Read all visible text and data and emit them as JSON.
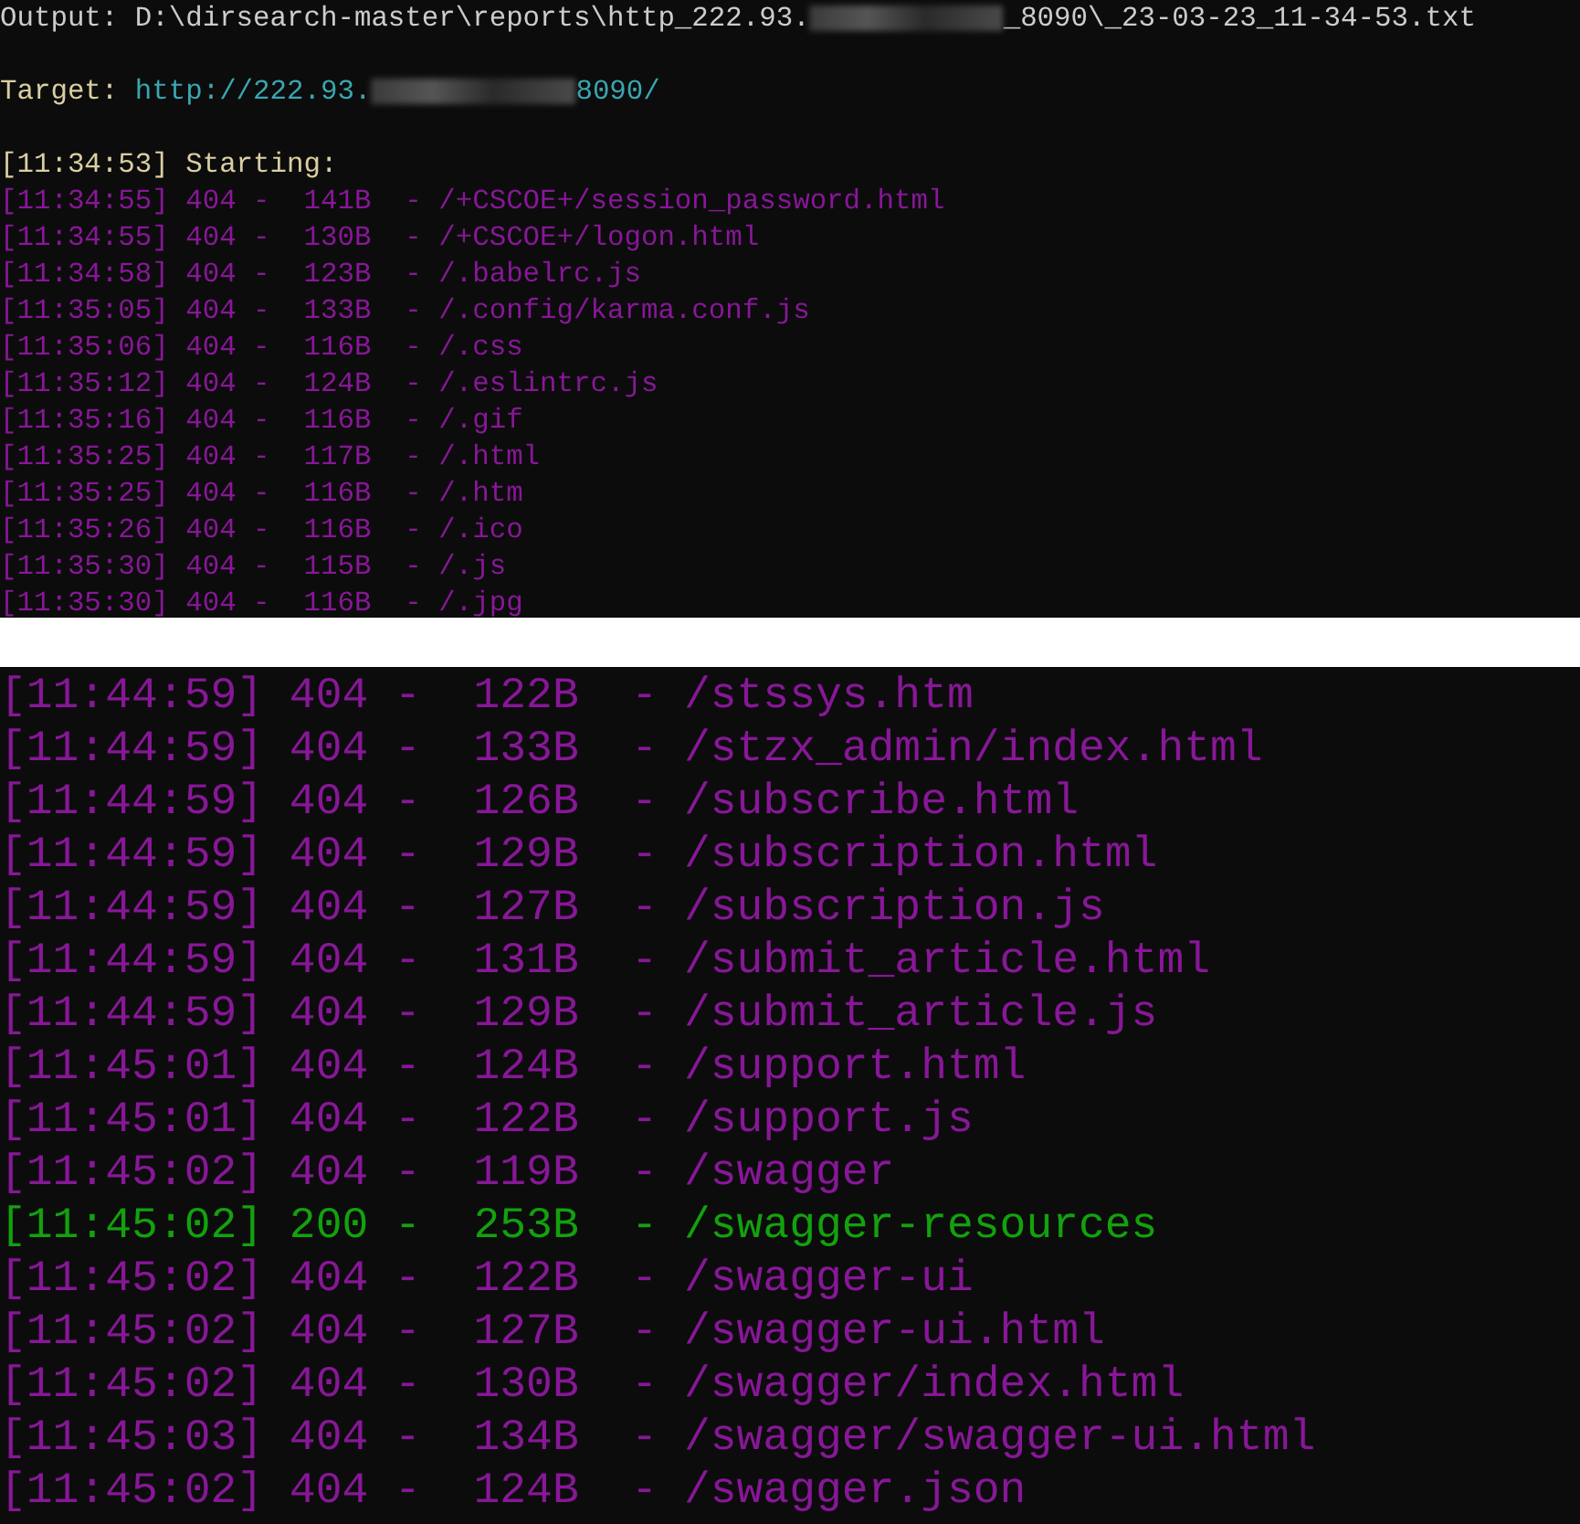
{
  "top_panel": {
    "output": {
      "label": "Output: D:\\dirsearch-master\\reports\\http_222.93.",
      "suffix": "_8090\\_23-03-23_11-34-53.txt"
    },
    "target": {
      "label": "Target: ",
      "url_start": "http://222.93.",
      "url_end": "8090/"
    },
    "start_line": "[11:34:53] Starting:",
    "rows": [
      {
        "line": "[11:34:55] 404 -  141B  - /+CSCOE+/session_password.html",
        "color": "#881798"
      },
      {
        "line": "[11:34:55] 404 -  130B  - /+CSCOE+/logon.html",
        "color": "#881798"
      },
      {
        "line": "[11:34:58] 404 -  123B  - /.babelrc.js",
        "color": "#881798"
      },
      {
        "line": "[11:35:05] 404 -  133B  - /.config/karma.conf.js",
        "color": "#881798"
      },
      {
        "line": "[11:35:06] 404 -  116B  - /.css",
        "color": "#881798"
      },
      {
        "line": "[11:35:12] 404 -  124B  - /.eslintrc.js",
        "color": "#881798"
      },
      {
        "line": "[11:35:16] 404 -  116B  - /.gif",
        "color": "#881798"
      },
      {
        "line": "[11:35:25] 404 -  117B  - /.html",
        "color": "#881798"
      },
      {
        "line": "[11:35:25] 404 -  116B  - /.htm",
        "color": "#881798"
      },
      {
        "line": "[11:35:26] 404 -  116B  - /.ico",
        "color": "#881798"
      },
      {
        "line": "[11:35:30] 404 -  115B  - /.js",
        "color": "#881798"
      },
      {
        "line": "[11:35:30] 404 -  116B  - /.jpg",
        "color": "#881798"
      }
    ]
  },
  "bottom_panel": {
    "rows": [
      {
        "line": "[11:44:59] 404 -  122B  - /stssys.htm",
        "color": "#881798"
      },
      {
        "line": "[11:44:59] 404 -  133B  - /stzx_admin/index.html",
        "color": "#881798"
      },
      {
        "line": "[11:44:59] 404 -  126B  - /subscribe.html",
        "color": "#881798"
      },
      {
        "line": "[11:44:59] 404 -  129B  - /subscription.html",
        "color": "#881798"
      },
      {
        "line": "[11:44:59] 404 -  127B  - /subscription.js",
        "color": "#881798"
      },
      {
        "line": "[11:44:59] 404 -  131B  - /submit_article.html",
        "color": "#881798"
      },
      {
        "line": "[11:44:59] 404 -  129B  - /submit_article.js",
        "color": "#881798"
      },
      {
        "line": "[11:45:01] 404 -  124B  - /support.html",
        "color": "#881798"
      },
      {
        "line": "[11:45:01] 404 -  122B  - /support.js",
        "color": "#881798"
      },
      {
        "line": "[11:45:02] 404 -  119B  - /swagger",
        "color": "#881798"
      },
      {
        "line": "[11:45:02] 200 -  253B  - /swagger-resources",
        "color": "#13a10e"
      },
      {
        "line": "[11:45:02] 404 -  122B  - /swagger-ui",
        "color": "#881798"
      },
      {
        "line": "[11:45:02] 404 -  127B  - /swagger-ui.html",
        "color": "#881798"
      },
      {
        "line": "[11:45:02] 404 -  130B  - /swagger/index.html",
        "color": "#881798"
      },
      {
        "line": "[11:45:03] 404 -  134B  - /swagger/swagger-ui.html",
        "color": "#881798"
      },
      {
        "line": "[11:45:02] 404 -  124B  - /swagger.json",
        "color": "#881798"
      }
    ]
  }
}
